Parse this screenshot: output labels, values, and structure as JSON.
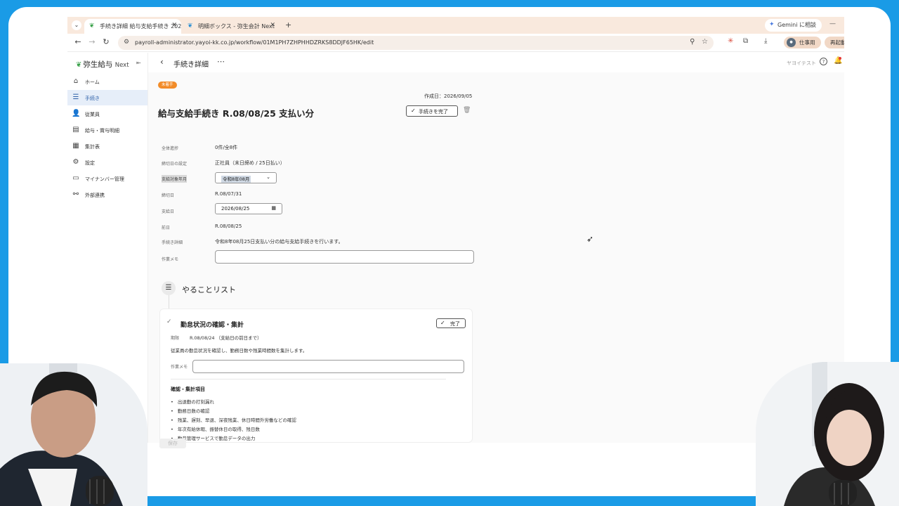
{
  "browser": {
    "tabs": [
      {
        "title": "手続き詳細 給与支給手続き 202",
        "active": true
      },
      {
        "title": "明細ボックス - 弥生会計 Next",
        "active": false
      }
    ],
    "gemini_label": "Gemini に相談",
    "url": "payroll-administrator.yayoi-kk.co.jp/workflow/01M1PH7ZHPHHDZRKS8DDJF65HK/edit",
    "profile_label": "仕事用",
    "restart_label": "再起動して"
  },
  "app": {
    "brand": "弥生給与",
    "brand_sub": "Next",
    "nav": [
      {
        "label": "ホーム",
        "icon": "home-icon"
      },
      {
        "label": "手続き",
        "icon": "tasks-icon"
      },
      {
        "label": "従業員",
        "icon": "person-icon"
      },
      {
        "label": "給与・賞与明細",
        "icon": "payslip-icon"
      },
      {
        "label": "集計表",
        "icon": "table-icon"
      },
      {
        "label": "設定",
        "icon": "gear-icon"
      },
      {
        "label": "マイナンバー管理",
        "icon": "id-card-icon"
      },
      {
        "label": "外部連携",
        "icon": "integration-icon"
      }
    ],
    "active_nav": "手続き",
    "header": {
      "title": "手続き詳細",
      "company": "ヤヨイテスト"
    }
  },
  "procedure": {
    "status_tag": "未着手",
    "created": "作成日：2026/09/05",
    "title": "給与支給手続き R.08/08/25 支払い分",
    "complete_label": "手続きを完了",
    "fields": [
      {
        "label": "全体進捗",
        "value": "0件/全8件"
      },
      {
        "label": "締切日の設定",
        "value": "正社員（末日締め / 25日払い）"
      },
      {
        "label": "支給対象年月",
        "value": "令和8年08月"
      },
      {
        "label": "締切日",
        "value": "R.08/07/31"
      },
      {
        "label": "支給日",
        "value": "2026/08/25"
      },
      {
        "label": "前日",
        "value": "R.08/08/25"
      },
      {
        "label": "手続き詳細",
        "value": "令和8年08月25日支払い分の給与支給手続きを行います。"
      },
      {
        "label": "作業メモ",
        "value": ""
      }
    ]
  },
  "todo": {
    "title": "やることリスト",
    "card": {
      "title": "勤怠状況の確認・集計",
      "complete_label": "完了",
      "deadline_label": "期限",
      "deadline_value": "R.08/08/24 （支給日の前日まで）",
      "description": "従業員の勤怠状況を確認し、勤務日数や残業時間数を集計します。",
      "memo_label": "作業メモ",
      "subtitle": "確認・集計項目",
      "items": [
        "出退勤の打刻漏れ",
        "勤務日数の確認",
        "残業、遅刻、早退、深夜残業、休日時間外労働などの確認",
        "年次有給休暇、振替休日の取得、残日数",
        "勤怠管理サービスで勤怠データの出力"
      ]
    },
    "save_label": "保存"
  }
}
